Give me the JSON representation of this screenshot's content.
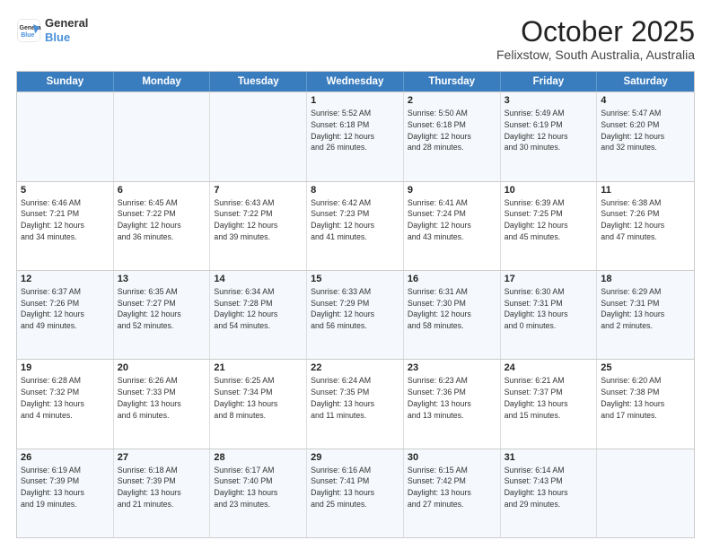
{
  "header": {
    "logo_line1": "General",
    "logo_line2": "Blue",
    "title": "October 2025",
    "subtitle": "Felixstow, South Australia, Australia"
  },
  "weekdays": [
    "Sunday",
    "Monday",
    "Tuesday",
    "Wednesday",
    "Thursday",
    "Friday",
    "Saturday"
  ],
  "rows": [
    [
      {
        "day": "",
        "info": ""
      },
      {
        "day": "",
        "info": ""
      },
      {
        "day": "",
        "info": ""
      },
      {
        "day": "1",
        "info": "Sunrise: 5:52 AM\nSunset: 6:18 PM\nDaylight: 12 hours\nand 26 minutes."
      },
      {
        "day": "2",
        "info": "Sunrise: 5:50 AM\nSunset: 6:18 PM\nDaylight: 12 hours\nand 28 minutes."
      },
      {
        "day": "3",
        "info": "Sunrise: 5:49 AM\nSunset: 6:19 PM\nDaylight: 12 hours\nand 30 minutes."
      },
      {
        "day": "4",
        "info": "Sunrise: 5:47 AM\nSunset: 6:20 PM\nDaylight: 12 hours\nand 32 minutes."
      }
    ],
    [
      {
        "day": "5",
        "info": "Sunrise: 6:46 AM\nSunset: 7:21 PM\nDaylight: 12 hours\nand 34 minutes."
      },
      {
        "day": "6",
        "info": "Sunrise: 6:45 AM\nSunset: 7:22 PM\nDaylight: 12 hours\nand 36 minutes."
      },
      {
        "day": "7",
        "info": "Sunrise: 6:43 AM\nSunset: 7:22 PM\nDaylight: 12 hours\nand 39 minutes."
      },
      {
        "day": "8",
        "info": "Sunrise: 6:42 AM\nSunset: 7:23 PM\nDaylight: 12 hours\nand 41 minutes."
      },
      {
        "day": "9",
        "info": "Sunrise: 6:41 AM\nSunset: 7:24 PM\nDaylight: 12 hours\nand 43 minutes."
      },
      {
        "day": "10",
        "info": "Sunrise: 6:39 AM\nSunset: 7:25 PM\nDaylight: 12 hours\nand 45 minutes."
      },
      {
        "day": "11",
        "info": "Sunrise: 6:38 AM\nSunset: 7:26 PM\nDaylight: 12 hours\nand 47 minutes."
      }
    ],
    [
      {
        "day": "12",
        "info": "Sunrise: 6:37 AM\nSunset: 7:26 PM\nDaylight: 12 hours\nand 49 minutes."
      },
      {
        "day": "13",
        "info": "Sunrise: 6:35 AM\nSunset: 7:27 PM\nDaylight: 12 hours\nand 52 minutes."
      },
      {
        "day": "14",
        "info": "Sunrise: 6:34 AM\nSunset: 7:28 PM\nDaylight: 12 hours\nand 54 minutes."
      },
      {
        "day": "15",
        "info": "Sunrise: 6:33 AM\nSunset: 7:29 PM\nDaylight: 12 hours\nand 56 minutes."
      },
      {
        "day": "16",
        "info": "Sunrise: 6:31 AM\nSunset: 7:30 PM\nDaylight: 12 hours\nand 58 minutes."
      },
      {
        "day": "17",
        "info": "Sunrise: 6:30 AM\nSunset: 7:31 PM\nDaylight: 13 hours\nand 0 minutes."
      },
      {
        "day": "18",
        "info": "Sunrise: 6:29 AM\nSunset: 7:31 PM\nDaylight: 13 hours\nand 2 minutes."
      }
    ],
    [
      {
        "day": "19",
        "info": "Sunrise: 6:28 AM\nSunset: 7:32 PM\nDaylight: 13 hours\nand 4 minutes."
      },
      {
        "day": "20",
        "info": "Sunrise: 6:26 AM\nSunset: 7:33 PM\nDaylight: 13 hours\nand 6 minutes."
      },
      {
        "day": "21",
        "info": "Sunrise: 6:25 AM\nSunset: 7:34 PM\nDaylight: 13 hours\nand 8 minutes."
      },
      {
        "day": "22",
        "info": "Sunrise: 6:24 AM\nSunset: 7:35 PM\nDaylight: 13 hours\nand 11 minutes."
      },
      {
        "day": "23",
        "info": "Sunrise: 6:23 AM\nSunset: 7:36 PM\nDaylight: 13 hours\nand 13 minutes."
      },
      {
        "day": "24",
        "info": "Sunrise: 6:21 AM\nSunset: 7:37 PM\nDaylight: 13 hours\nand 15 minutes."
      },
      {
        "day": "25",
        "info": "Sunrise: 6:20 AM\nSunset: 7:38 PM\nDaylight: 13 hours\nand 17 minutes."
      }
    ],
    [
      {
        "day": "26",
        "info": "Sunrise: 6:19 AM\nSunset: 7:39 PM\nDaylight: 13 hours\nand 19 minutes."
      },
      {
        "day": "27",
        "info": "Sunrise: 6:18 AM\nSunset: 7:39 PM\nDaylight: 13 hours\nand 21 minutes."
      },
      {
        "day": "28",
        "info": "Sunrise: 6:17 AM\nSunset: 7:40 PM\nDaylight: 13 hours\nand 23 minutes."
      },
      {
        "day": "29",
        "info": "Sunrise: 6:16 AM\nSunset: 7:41 PM\nDaylight: 13 hours\nand 25 minutes."
      },
      {
        "day": "30",
        "info": "Sunrise: 6:15 AM\nSunset: 7:42 PM\nDaylight: 13 hours\nand 27 minutes."
      },
      {
        "day": "31",
        "info": "Sunrise: 6:14 AM\nSunset: 7:43 PM\nDaylight: 13 hours\nand 29 minutes."
      },
      {
        "day": "",
        "info": ""
      }
    ]
  ],
  "alt_rows": [
    0,
    2,
    4
  ]
}
